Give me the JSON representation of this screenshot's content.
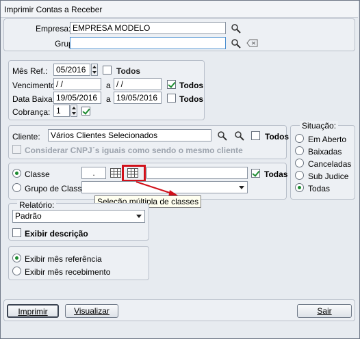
{
  "window": {
    "title": "Imprimir Contas a Receber"
  },
  "header": {
    "empresa_label": "Empresa:",
    "empresa_value": "EMPRESA MODELO",
    "grupos_label": "Grupos:",
    "grupos_value": ""
  },
  "periodo": {
    "mes_ref_label": "Mês Ref.:",
    "mes_ref_value": "05/2016",
    "mes_ref_todos": "Todos",
    "vencimento_label": "Vencimento:",
    "vencimento_from": " / /",
    "vencimento_a": "a",
    "vencimento_to": " / /",
    "vencimento_todos": "Todos",
    "data_baixa_label": "Data Baixa:",
    "data_baixa_from": "19/05/2016",
    "data_baixa_a": "a",
    "data_baixa_to": "19/05/2016",
    "data_baixa_todos": "Todos",
    "cobranca_label": "Cobrança:",
    "cobranca_value": "1",
    "cobranca_todos": "Todas"
  },
  "cliente": {
    "label": "Cliente:",
    "value": "Vários Clientes Selecionados",
    "todos": "Todos",
    "considerar_cnpj": "Considerar CNPJ´s iguais como sendo o mesmo cliente"
  },
  "situacao": {
    "caption": "Situação:",
    "options": [
      "Em Aberto",
      "Baixadas",
      "Canceladas",
      "Sub Judice",
      "Todas"
    ],
    "selected": "Todas"
  },
  "classe": {
    "classe_label": "Classe",
    "classe_code": ".",
    "todas": "Todas",
    "grupo_label": "Grupo de Classe:",
    "grupo_value": "",
    "tooltip": "Seleção múltipla de classes"
  },
  "relatorio": {
    "caption": "Relatório:",
    "value": "Padrão",
    "exibir_descricao": "Exibir descrição"
  },
  "exibir_mes": {
    "referencia": "Exibir mês referência",
    "recebimento": "Exibir mês recebimento"
  },
  "buttons": {
    "imprimir": "Imprimir",
    "visualizar": "Visualizar",
    "sair": "Sair"
  },
  "colors": {
    "accent": "#1a8a2e",
    "highlight": "#d0101a"
  }
}
